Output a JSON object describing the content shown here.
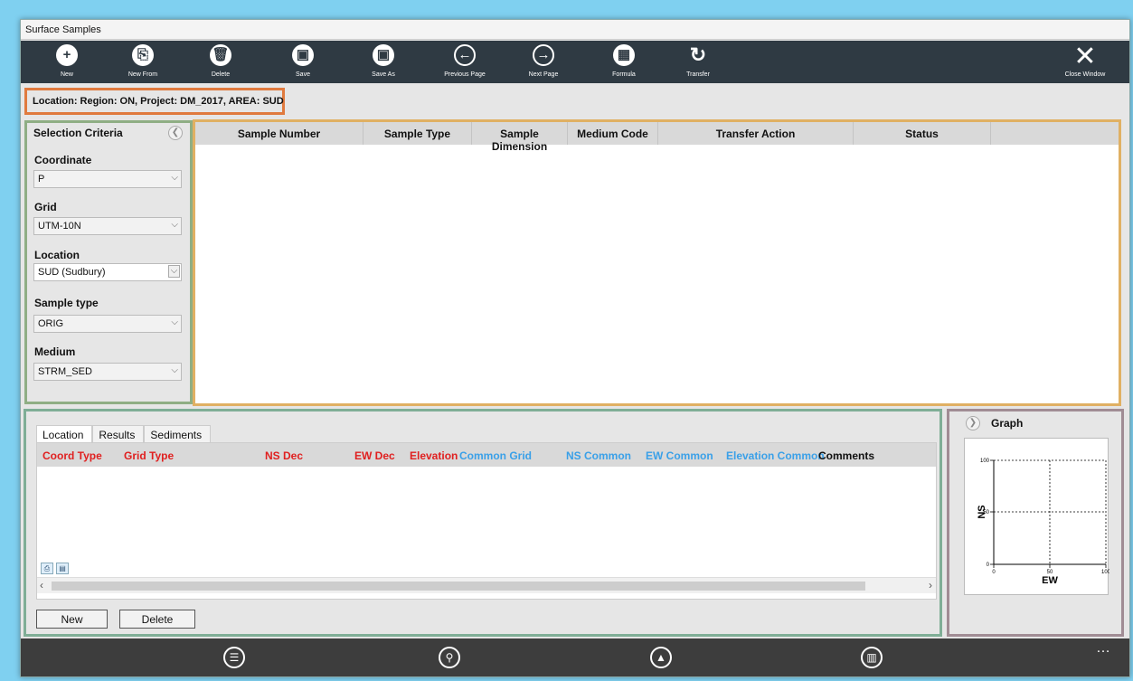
{
  "window": {
    "title": "Surface Samples"
  },
  "toolbar": {
    "new": "New",
    "new_from": "New From",
    "delete": "Delete",
    "save": "Save",
    "save_as": "Save As",
    "previous_page": "Previous Page",
    "next_page": "Next Page",
    "formula": "Formula",
    "transfer": "Transfer",
    "close_window": "Close Window"
  },
  "location_bar": "Location: Region: ON, Project: DM_2017, AREA: SUD",
  "selection": {
    "header": "Selection Criteria",
    "coordinate_label": "Coordinate",
    "coordinate_value": "P",
    "grid_label": "Grid",
    "grid_value": "UTM-10N",
    "location_label": "Location",
    "location_value": "SUD (Sudbury)",
    "sample_type_label": "Sample type",
    "sample_type_value": "ORIG",
    "medium_label": "Medium",
    "medium_value": "STRM_SED"
  },
  "samples_table": {
    "columns": [
      "Sample Number",
      "Sample Type",
      "Sample Dimension",
      "Medium Code",
      "Transfer Action",
      "Status",
      ""
    ]
  },
  "bottom": {
    "tabs": [
      "Location",
      "Results",
      "Sediments"
    ],
    "columns": [
      "Coord Type",
      "Grid Type",
      "NS Dec",
      "EW Dec",
      "Elevation",
      "Common Grid",
      "NS Common",
      "EW Common",
      "Elevation Common",
      "Comments"
    ],
    "new_button": "New",
    "delete_button": "Delete"
  },
  "graph": {
    "title": "Graph",
    "xlabel": "EW",
    "ylabel": "NS",
    "x_ticks": [
      "0",
      "50",
      "100"
    ],
    "y_ticks": [
      "0",
      "50",
      "100"
    ]
  },
  "colors": {
    "toolbar_bg": "#2f3a43",
    "red_header": "#e02020",
    "blue_header": "#3aa0e8",
    "location_border": "#e07a3e",
    "selection_border": "#8fae84",
    "samples_border": "#e0b063",
    "bottom_border": "#7fae96",
    "graph_border": "#a08c94"
  }
}
